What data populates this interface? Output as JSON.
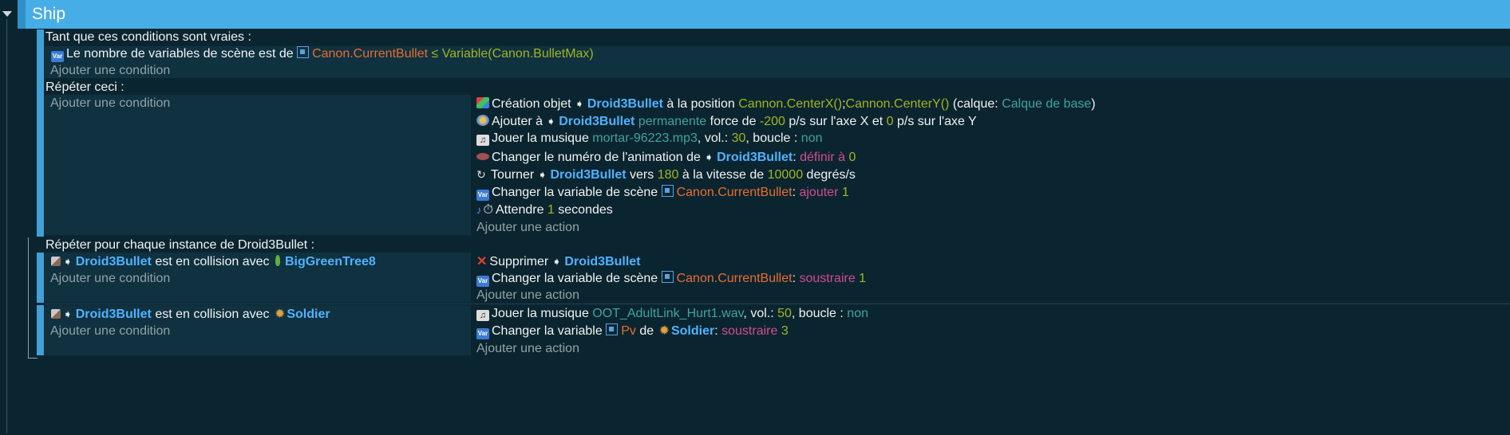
{
  "group": {
    "title": "Ship"
  },
  "conditions_loop": {
    "header": "Tant que ces conditions sont vraies :",
    "cond1": {
      "prefix": "Le nombre de variables de scène est de",
      "variable": "Canon.CurrentBullet",
      "operator": "≤",
      "value": "Variable(Canon.BulletMax)"
    },
    "add_condition": "Ajouter une condition"
  },
  "repeat": {
    "header": "Répéter ceci :",
    "add_condition": "Ajouter une condition",
    "actions": {
      "a1": {
        "t1": "Création objet",
        "obj": "Droid3Bullet",
        "t2": "à la position",
        "x": "Cannon.CenterX()",
        "sep": ";",
        "y": "Cannon.CenterY()",
        "t3": "(calque:",
        "layer": "Calque de base",
        "t4": ")"
      },
      "a2": {
        "t1": "Ajouter à",
        "obj": "Droid3Bullet",
        "mode": "permanente",
        "t2": "force de",
        "vx": "-200",
        "t3": "p/s sur l'axe X et",
        "vy": "0",
        "t4": "p/s sur l'axe Y"
      },
      "a3": {
        "t1": "Jouer la musique",
        "file": "mortar-96223.mp3",
        "t2": ", vol.:",
        "vol": "30",
        "t3": ", boucle :",
        "loop": "non"
      },
      "a4": {
        "t1": "Changer le numéro de l'animation de",
        "obj": "Droid3Bullet",
        "t2": ":",
        "op": "définir à",
        "val": "0"
      },
      "a5": {
        "t1": "Tourner",
        "obj": "Droid3Bullet",
        "t2": "vers",
        "angle": "180",
        "t3": "à la vitesse de",
        "speed": "10000",
        "t4": "degrés/s"
      },
      "a6": {
        "t1": "Changer la variable de scène",
        "var": "Canon.CurrentBullet",
        "t2": ":",
        "op": "ajouter",
        "val": "1"
      },
      "a7": {
        "t1": "Attendre",
        "val": "1",
        "t2": "secondes"
      }
    },
    "add_action": "Ajouter une action"
  },
  "foreach": {
    "header": "Répéter pour chaque instance de Droid3Bullet :",
    "sub1": {
      "cond": {
        "obj": "Droid3Bullet",
        "t1": "est en collision avec",
        "target": "BigGreenTree8"
      },
      "add_condition": "Ajouter une condition",
      "act1": {
        "t1": "Supprimer",
        "obj": "Droid3Bullet"
      },
      "act2": {
        "t1": "Changer la variable de scène",
        "var": "Canon.CurrentBullet",
        "t2": ":",
        "op": "soustraire",
        "val": "1"
      },
      "add_action": "Ajouter une action"
    },
    "sub2": {
      "cond": {
        "obj": "Droid3Bullet",
        "t1": "est en collision avec",
        "target": "Soldier"
      },
      "add_condition": "Ajouter une condition",
      "act1": {
        "t1": "Jouer la musique",
        "file": "OOT_AdultLink_Hurt1.wav",
        "t2": ", vol.:",
        "vol": "50",
        "t3": ", boucle :",
        "loop": "non"
      },
      "act2": {
        "t1": "Changer la variable",
        "var": "Pv",
        "t2": "de",
        "obj": "Soldier",
        "t3": ":",
        "op": "soustraire",
        "val": "3"
      },
      "add_action": "Ajouter une action"
    }
  },
  "colors": {
    "header_bar": "#47ade6",
    "background": "#0b2530",
    "object": "#4fb2ff",
    "variable": "#e86d2f",
    "number": "#a2b422",
    "string": "#41a39a",
    "operation": "#d24b92"
  },
  "icons": [
    "collapse-arrow-icon",
    "scene-variable-icon",
    "create-object-icon",
    "force-icon",
    "music-icon",
    "animation-icon",
    "rotate-icon",
    "wait-icon",
    "collision-icon",
    "delete-icon",
    "tree-icon",
    "soldier-icon"
  ]
}
